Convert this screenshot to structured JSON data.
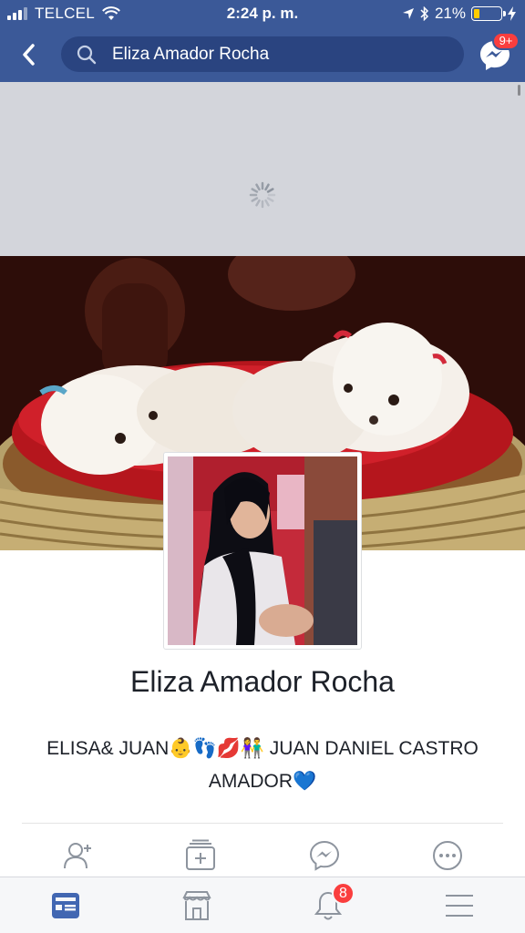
{
  "status_bar": {
    "carrier": "TELCEL",
    "time": "2:24 p. m.",
    "battery_percent": "21%",
    "battery_level": 0.21,
    "icons": [
      "signal-icon",
      "wifi-icon",
      "location-arrow-icon",
      "bluetooth-icon",
      "battery-icon",
      "charging-icon"
    ]
  },
  "nav": {
    "back_icon": "chevron-left-icon",
    "search_icon": "search-icon",
    "search_value": "Eliza Amador Rocha",
    "messenger_icon": "messenger-icon",
    "messenger_badge": "9+"
  },
  "profile": {
    "name": "Eliza Amador Rocha",
    "bio": "ELISA& JUAN👶👣💋👫 JUAN DANIEL CASTRO AMADOR💙",
    "cover_photo_icon": "cover-photo",
    "profile_photo_icon": "profile-photo"
  },
  "actions": [
    {
      "icon": "add-friend-icon"
    },
    {
      "icon": "follow-icon"
    },
    {
      "icon": "messenger-icon"
    },
    {
      "icon": "more-icon"
    }
  ],
  "tabs": [
    {
      "icon": "news-feed-icon",
      "active": true
    },
    {
      "icon": "marketplace-icon",
      "active": false
    },
    {
      "icon": "notifications-icon",
      "active": false,
      "badge": "8"
    },
    {
      "icon": "menu-icon",
      "active": false
    }
  ],
  "colors": {
    "brand": "#3b5998",
    "badge": "#fa3e3e",
    "active_tab": "#4267b2",
    "inactive_icon": "#8d949e"
  }
}
